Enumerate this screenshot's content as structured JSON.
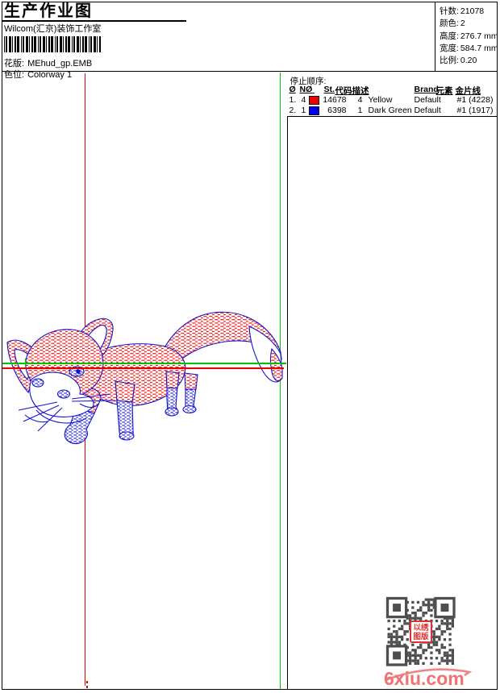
{
  "header": {
    "title": "生产作业图",
    "subtitle": "Wilcom(汇京)装饰工作室",
    "fields": [
      {
        "label": "花版:",
        "value": "MEhud_gp.EMB"
      },
      {
        "label": "色位:",
        "value": "Colorway 1"
      }
    ]
  },
  "info_panel": {
    "rows": [
      {
        "label": "针数:",
        "value": "21078"
      },
      {
        "label": "颜色:",
        "value": "2"
      },
      {
        "label": "高度:",
        "value": "276.7 mm"
      },
      {
        "label": "宽度:",
        "value": "584.7 mm"
      },
      {
        "label": "比例:",
        "value": "0.20"
      }
    ]
  },
  "stop_sequence": {
    "title": "停止顺序:",
    "columns": {
      "stop": "Ø",
      "needle": "NØ",
      "stitches": "St.",
      "code": "代码",
      "description": "描述",
      "brand": "Brand",
      "element": "元素",
      "sequin": "金片线"
    },
    "rows": [
      {
        "stop": "1.",
        "needle": "4",
        "color": "#ee0000",
        "stitches": "14678",
        "code": "4",
        "description": "Yellow",
        "brand": "Default",
        "sequin": "#1 (4228)"
      },
      {
        "stop": "2.",
        "needle": "1",
        "color": "#0000ee",
        "stitches": "6398",
        "code": "1",
        "description": "Dark Green",
        "brand": "Default",
        "sequin": "#1 (1917)"
      }
    ]
  },
  "design": {
    "subject": "fox embroidery stitch preview",
    "colors": {
      "stitch_red": "#ee0000",
      "stitch_blue": "#1616d8",
      "outline_blue": "#1414cc",
      "start_line_green": "#00c400",
      "end_line_red": "#ea0000"
    }
  },
  "qr": {
    "stamp_text": "以绣图版"
  },
  "watermark": {
    "text": "6xiu.com",
    "color": "#ee7474"
  }
}
